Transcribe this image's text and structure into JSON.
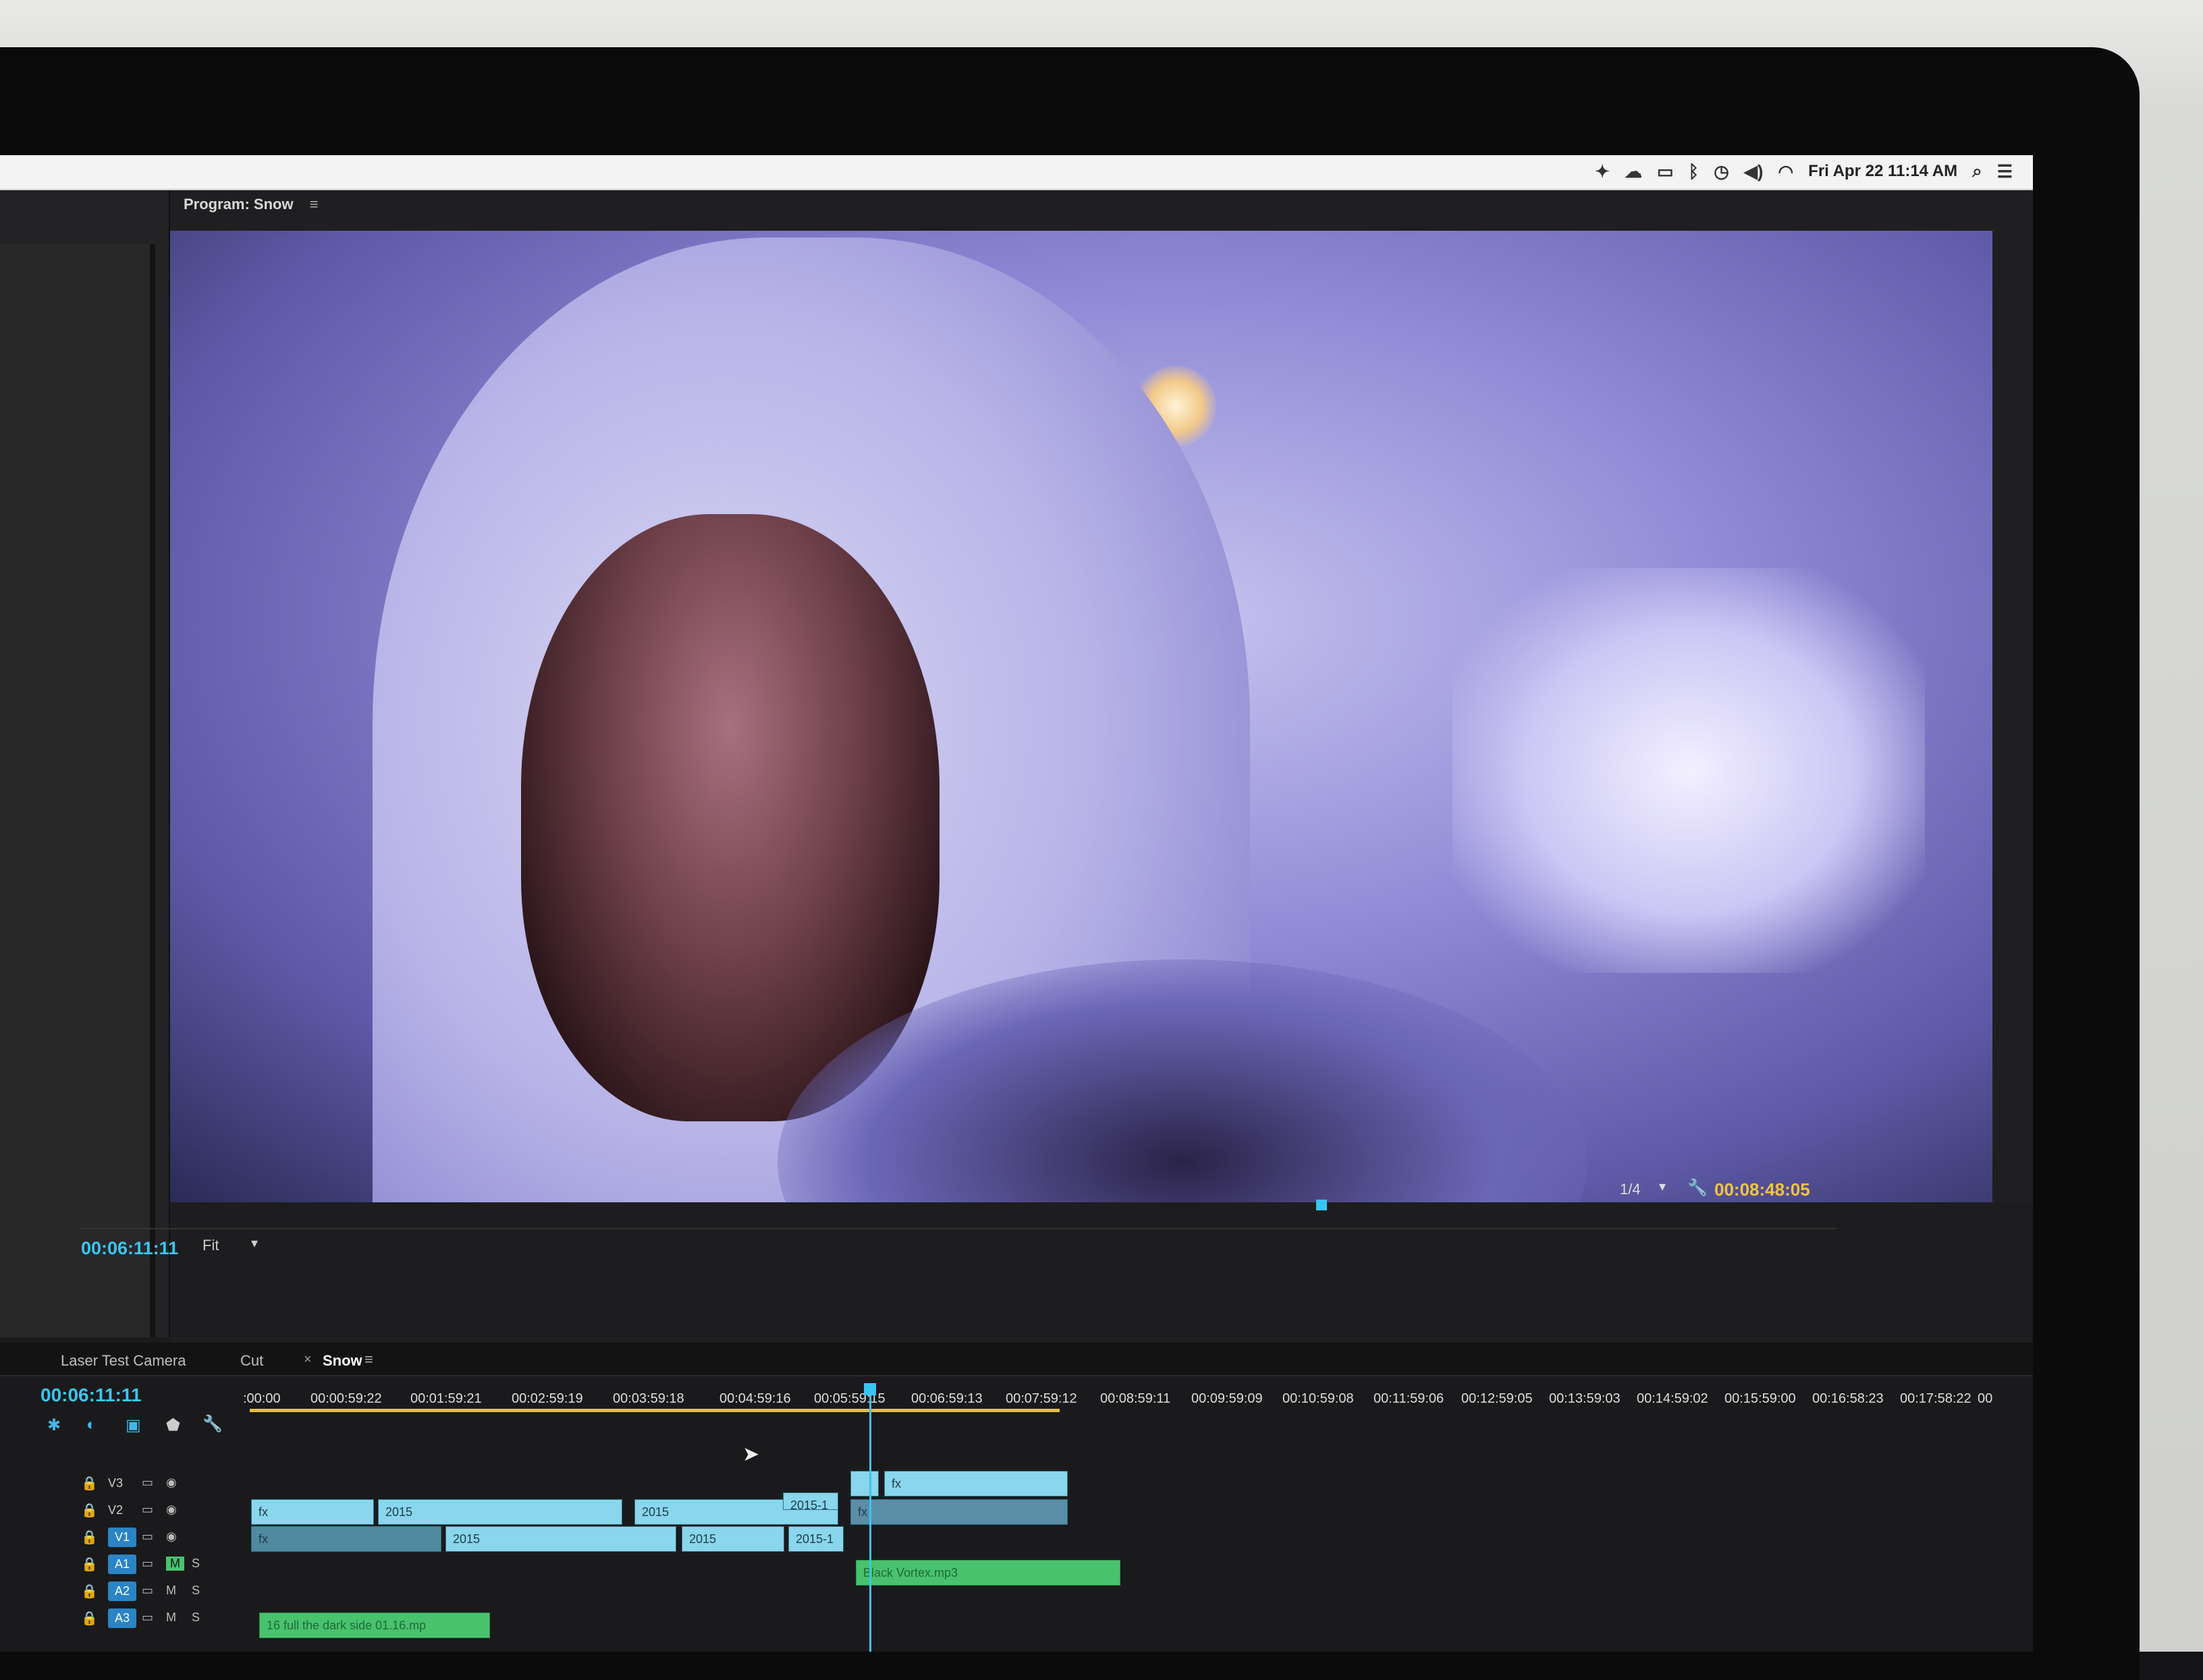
{
  "menubar": {
    "date_time": "Fri Apr 22 11:14 AM",
    "icons": [
      "dropbox-icon",
      "creative-cloud-icon",
      "airplay-icon",
      "bluetooth-icon",
      "time-machine-icon",
      "volume-icon",
      "wifi-icon",
      "spotlight-search-icon",
      "notification-center-icon"
    ]
  },
  "program_monitor": {
    "tab_label": "Program: Snow",
    "playhead_timecode": "00:06:11:11",
    "zoom": "Fit",
    "resolution": "1/4",
    "duration": "00:08:48:05"
  },
  "sequence": {
    "tabs": [
      "Laser Test Camera",
      "Cut",
      "Snow"
    ],
    "active_tab": "Snow",
    "timecode": "00:06:11:11",
    "ruler": [
      ":00:00",
      "00:00:59:22",
      "00:01:59:21",
      "00:02:59:19",
      "00:03:59:18",
      "00:04:59:16",
      "00:05:59:15",
      "00:06:59:13",
      "00:07:59:12",
      "00:08:59:11",
      "00:09:59:09",
      "00:10:59:08",
      "00:11:59:06",
      "00:12:59:05",
      "00:13:59:03",
      "00:14:59:02",
      "00:15:59:00",
      "00:16:58:23",
      "00:17:58:22",
      "00"
    ],
    "tracks": {
      "v3": "V3",
      "v2": "V2",
      "v1": "V1",
      "a1": "A1",
      "a2": "A2",
      "a3": "A3"
    },
    "clip_labels": {
      "v2_a": "2015",
      "v2_b": "2015",
      "v2_c": "2015-1",
      "v1_a": "2015",
      "v1_b": "2015",
      "v1_c": "2015-1",
      "a1_clip": "Black Vortex.mp3",
      "a3_clip": "16 full the dark side 01.16.mp"
    },
    "fx_badge": "fx",
    "mute": "M",
    "solo": "S"
  },
  "colors": {
    "accent": "#38c6f0",
    "audio_clip": "#49c26e",
    "video_clip": "#8ad6ec",
    "work_area": "#e2c232"
  }
}
